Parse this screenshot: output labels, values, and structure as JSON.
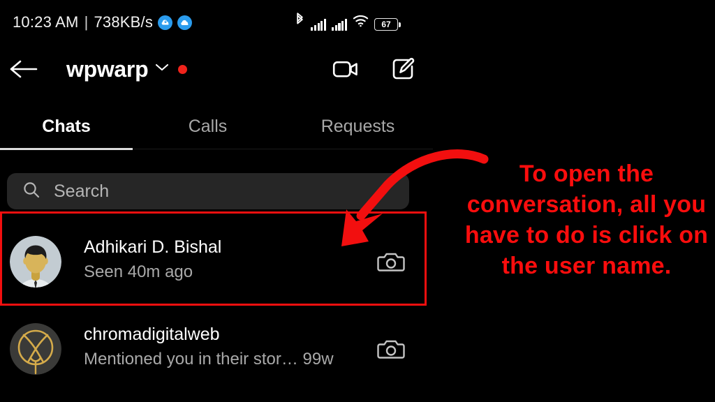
{
  "status_bar": {
    "time": "10:23 AM",
    "separator": "|",
    "network_speed": "738KB/s",
    "icons": [
      "cloud-download-icon",
      "cloud-icon",
      "bluetooth-icon",
      "signal-bars-sim1-icon",
      "signal-bars-sim2-icon",
      "wifi-icon",
      "battery-icon"
    ],
    "battery_level": "67"
  },
  "header": {
    "back_icon": "back-arrow-icon",
    "account_name": "wpwarp",
    "chevron_icon": "chevron-down-icon",
    "unread_dot": true,
    "video_call_icon": "video-camera-icon",
    "compose_icon": "compose-edit-icon"
  },
  "tabs": {
    "items": [
      {
        "label": "Chats",
        "active": true
      },
      {
        "label": "Calls",
        "active": false
      },
      {
        "label": "Requests",
        "active": false
      }
    ]
  },
  "search": {
    "icon": "search-icon",
    "placeholder": "Search",
    "value": ""
  },
  "chats": [
    {
      "name": "Adhikari D. Bishal",
      "status": "Seen 40m ago",
      "age": "",
      "avatar": "person-photo-avatar",
      "action_icon": "camera-icon",
      "highlighted": true
    },
    {
      "name": "chromadigitalweb",
      "status": "Mentioned you in their stor…",
      "age": "99w",
      "avatar": "gold-logo-avatar",
      "action_icon": "camera-icon",
      "highlighted": false
    }
  ],
  "annotation": {
    "callout_text": "To open the conversation, all you have to do is click on the user name.",
    "highlight_color": "#f20f0f",
    "text_color": "#fb0d0d",
    "arrow_icon": "curved-arrow-icon"
  }
}
